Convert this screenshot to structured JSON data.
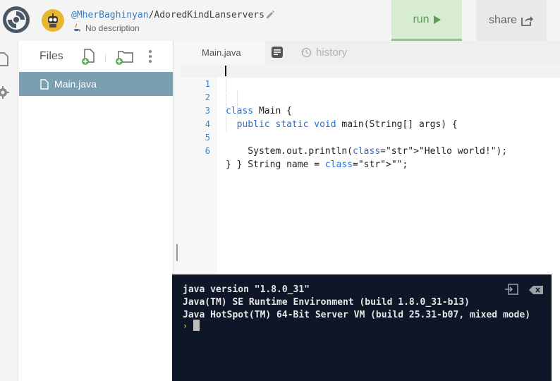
{
  "header": {
    "owner": "@MherBaghinyan",
    "separator": "/",
    "repl_name": "AdoredKindLanservers",
    "description": "No description",
    "run_label": "run",
    "share_label": "share"
  },
  "files_panel": {
    "title": "Files",
    "files": [
      {
        "name": "Main.java",
        "active": true
      }
    ]
  },
  "editor": {
    "active_tab": "Main.java",
    "history_label": "history",
    "lines": [
      {
        "number": "1",
        "text": "class Main {"
      },
      {
        "number": "2",
        "text": "  public static void main(String[] args) {"
      },
      {
        "number": "3",
        "text": "    System.out.println(\"Hello world!\");"
      },
      {
        "number": "4",
        "text": "    String name = \"\";"
      },
      {
        "number": "5",
        "text": "  }"
      },
      {
        "number": "6",
        "text": "}"
      }
    ]
  },
  "console": {
    "lines": [
      "java version \"1.8.0_31\"",
      "Java(TM) SE Runtime Environment (build 1.8.0_31-b13)",
      "Java HotSpot(TM) 64-Bit Server VM (build 25.31-b07, mixed mode)"
    ],
    "prompt": "›"
  },
  "colors": {
    "run_bg": "#d8ecd4",
    "run_text": "#5a9e5c",
    "active_file_bg": "#7a9fb0",
    "console_bg": "#0e1628",
    "keyword": "#2a6fd4",
    "string": "#b3283a",
    "line_number": "#3a83c5"
  }
}
